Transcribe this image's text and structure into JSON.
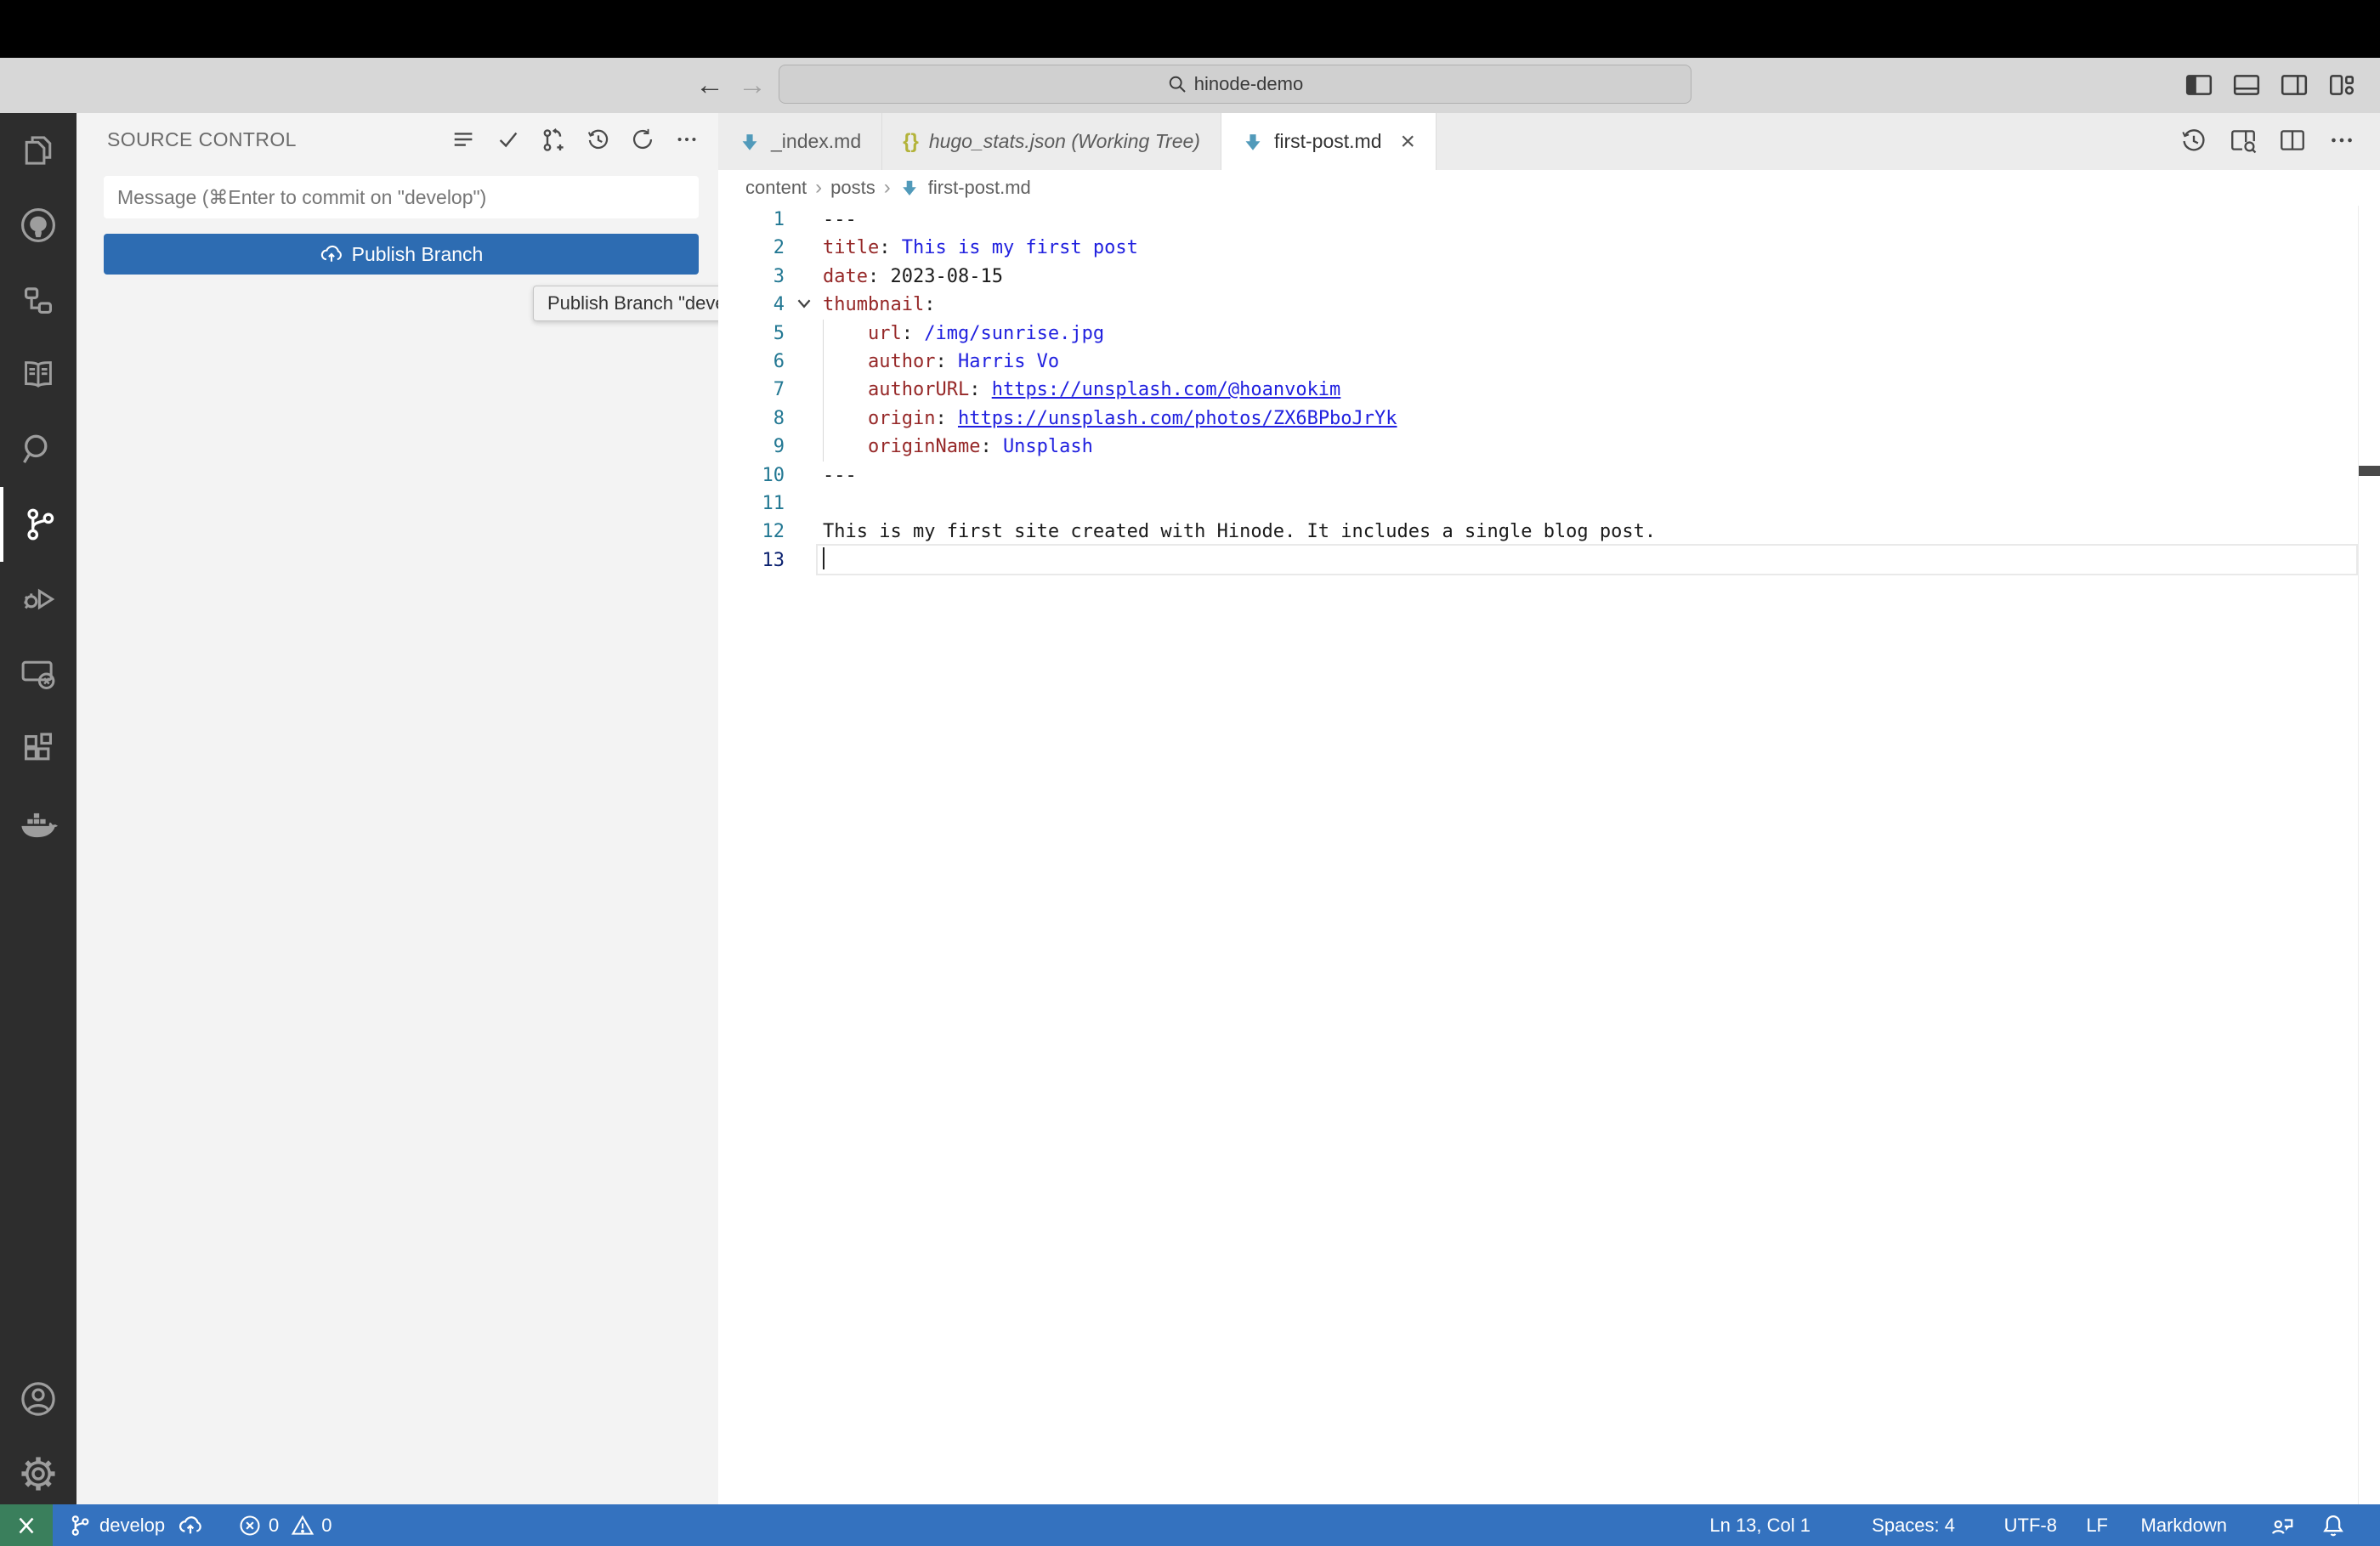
{
  "title_bar": {
    "back_arrow": "←",
    "forward_arrow": "→",
    "search_value": "hinode-demo"
  },
  "activity_bar": {
    "items": [
      "explorer",
      "github",
      "hierarchy",
      "docs",
      "search",
      "source-control",
      "run-debug",
      "remote-explorer",
      "extensions",
      "docker"
    ],
    "bottom_items": [
      "account",
      "settings"
    ],
    "active_item": "source-control"
  },
  "sidebar": {
    "title": "SOURCE CONTROL",
    "commit_message_placeholder": "Message (⌘Enter to commit on \"develop\")",
    "publish_button_label": "Publish Branch",
    "tooltip_text": "Publish Branch \"develop\"",
    "header_actions": [
      "view-as-list",
      "commit",
      "create-branch",
      "history",
      "refresh",
      "more-actions"
    ]
  },
  "editor_tabs": {
    "items": [
      {
        "label": "_index.md",
        "icon": "markdown"
      },
      {
        "label": "hugo_stats.json (Working Tree)",
        "icon": "json",
        "preview": true
      },
      {
        "label": "first-post.md",
        "icon": "markdown",
        "active": true,
        "close_label": "×"
      }
    ],
    "actions": [
      "timeline",
      "open-preview",
      "split-editor",
      "more-actions"
    ]
  },
  "breadcrumb": {
    "items": [
      "content",
      "posts",
      "first-post.md"
    ],
    "separator": "›"
  },
  "editor": {
    "lines": [
      {
        "num": "1",
        "tokens": [
          {
            "type": "plain",
            "text": "---"
          }
        ]
      },
      {
        "num": "2",
        "tokens": [
          {
            "type": "key",
            "text": "title"
          },
          {
            "type": "punct",
            "text": ": "
          },
          {
            "type": "value",
            "text": "This is my first post"
          }
        ]
      },
      {
        "num": "3",
        "tokens": [
          {
            "type": "key",
            "text": "date"
          },
          {
            "type": "punct",
            "text": ": "
          },
          {
            "type": "plain",
            "text": "2023-08-15"
          }
        ]
      },
      {
        "num": "4",
        "tokens": [
          {
            "type": "key",
            "text": "thumbnail"
          },
          {
            "type": "punct",
            "text": ":"
          }
        ]
      },
      {
        "num": "5",
        "tokens": [
          {
            "type": "plain",
            "text": "    "
          },
          {
            "type": "key",
            "text": "url"
          },
          {
            "type": "punct",
            "text": ": "
          },
          {
            "type": "value",
            "text": "/img/sunrise.jpg"
          }
        ]
      },
      {
        "num": "6",
        "tokens": [
          {
            "type": "plain",
            "text": "    "
          },
          {
            "type": "key",
            "text": "author"
          },
          {
            "type": "punct",
            "text": ": "
          },
          {
            "type": "value",
            "text": "Harris Vo"
          }
        ]
      },
      {
        "num": "7",
        "tokens": [
          {
            "type": "plain",
            "text": "    "
          },
          {
            "type": "key",
            "text": "authorURL"
          },
          {
            "type": "punct",
            "text": ": "
          },
          {
            "type": "link",
            "text": "https://unsplash.com/@hoanvokim"
          }
        ]
      },
      {
        "num": "8",
        "tokens": [
          {
            "type": "plain",
            "text": "    "
          },
          {
            "type": "key",
            "text": "origin"
          },
          {
            "type": "punct",
            "text": ": "
          },
          {
            "type": "link",
            "text": "https://unsplash.com/photos/ZX6BPboJrYk"
          }
        ]
      },
      {
        "num": "9",
        "tokens": [
          {
            "type": "plain",
            "text": "    "
          },
          {
            "type": "key",
            "text": "originName"
          },
          {
            "type": "punct",
            "text": ": "
          },
          {
            "type": "value",
            "text": "Unsplash"
          }
        ]
      },
      {
        "num": "10",
        "tokens": [
          {
            "type": "plain",
            "text": "---"
          }
        ]
      },
      {
        "num": "11",
        "tokens": []
      },
      {
        "num": "12",
        "tokens": [
          {
            "type": "plain",
            "text": "This is my first site created with Hinode. It includes a single blog post."
          }
        ]
      },
      {
        "num": "13",
        "tokens": []
      }
    ]
  },
  "status_bar": {
    "branch": "develop",
    "errors": "0",
    "warnings": "0",
    "cursor_position": "Ln 13, Col 1",
    "indentation": "Spaces: 4",
    "encoding": "UTF-8",
    "eol": "LF",
    "language": "Markdown"
  },
  "colors": {
    "status_bar": "#3472bf",
    "remote_indicator": "#3a7f5c",
    "publish_button": "#2d6cb2",
    "activity_bar": "#2d2d2d",
    "sidebar_bg": "#f3f3f3",
    "yaml_key": "#962828",
    "yaml_value": "#2121df",
    "markdown_icon": "#519aba",
    "json_icon": "#b3b33a"
  }
}
